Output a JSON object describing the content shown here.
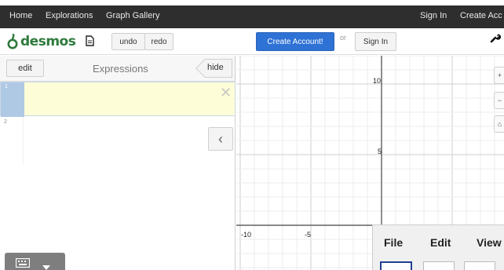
{
  "nav": {
    "items": [
      "Home",
      "Explorations",
      "Graph Gallery"
    ],
    "sign_in": "Sign In",
    "create_account": "Create Acc"
  },
  "toolbar": {
    "logo_text": "desmos",
    "undo": "undo",
    "redo": "redo",
    "create_account": "Create Account!",
    "or": "or",
    "sign_in": "Sign In"
  },
  "expressions": {
    "edit": "edit",
    "title": "Expressions",
    "hide": "hide",
    "rows": [
      {
        "number": "1",
        "value": ""
      },
      {
        "number": "2",
        "value": ""
      }
    ]
  },
  "graph": {
    "x_ticks": [
      "-10",
      "-5"
    ],
    "y_ticks": [
      "10",
      "5"
    ]
  },
  "overlay_menu": {
    "items": [
      "File",
      "Edit",
      "View"
    ]
  },
  "colors": {
    "nav_bg": "#2e2e2e",
    "primary": "#2f72d6",
    "logo_green": "#2f7a3d",
    "active_row": "#fdfdd7",
    "row_gutter": "#afc9e4"
  }
}
